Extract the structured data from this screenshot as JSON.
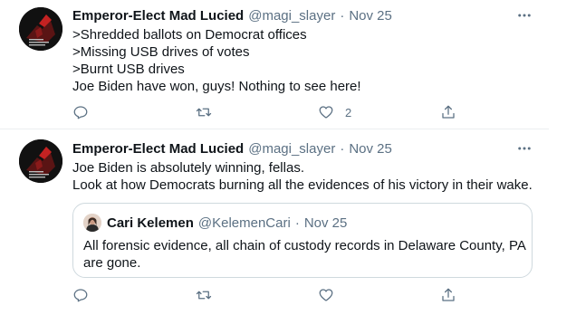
{
  "tweets": [
    {
      "author_name": "Emperor-Elect Mad Lucied",
      "handle": "@magi_slayer",
      "separator": "·",
      "date": "Nov 25",
      "lines": [
        ">Shredded ballots on Democrat offices",
        ">Missing USB drives of votes",
        ">Burnt USB drives",
        "Joe Biden have won, guys! Nothing to see here!"
      ],
      "like_count": "2"
    },
    {
      "author_name": "Emperor-Elect Mad Lucied",
      "handle": "@magi_slayer",
      "separator": "·",
      "date": "Nov 25",
      "lines": [
        "Joe Biden is absolutely winning, fellas.",
        "Look at how Democrats burning all the evidences of his victory in their wake."
      ],
      "quote": {
        "author_name": "Cari Kelemen",
        "handle": "@KelemenCari",
        "separator": "·",
        "date": "Nov 25",
        "lines": [
          "All forensic evidence, all chain of custody records in Delaware County, PA",
          "are gone."
        ]
      }
    }
  ],
  "icons": {
    "more": "more-horizontal-icon",
    "reply": "reply-icon",
    "retweet": "retweet-icon",
    "like": "heart-icon",
    "share": "share-icon"
  },
  "colors": {
    "text": "#0f1419",
    "secondary": "#5b7083",
    "border": "#ebeef0",
    "quote_border": "#cfd9de"
  }
}
